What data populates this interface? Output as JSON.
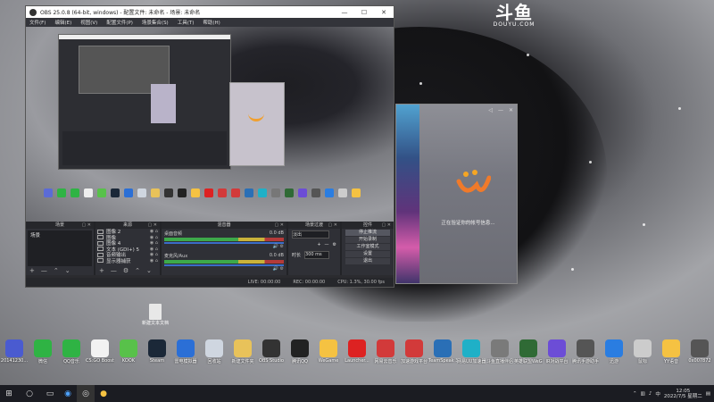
{
  "douyu": {
    "logo_glyph": "斗鱼",
    "url": "DOUYU.COM"
  },
  "obs": {
    "title": "OBS 25.0.8 (64-bit, windows) - 配置文件: 未命名 - 场景: 未命名",
    "menu": [
      "文件(F)",
      "编辑(E)",
      "视图(V)",
      "配置文件(P)",
      "场景集合(S)",
      "工具(T)",
      "帮助(H)"
    ],
    "docks": {
      "scenes": {
        "title": "场景",
        "items": [
          "场景"
        ]
      },
      "sources": {
        "title": "来源",
        "items": [
          {
            "name": "图像 2"
          },
          {
            "name": "图像"
          },
          {
            "name": "图像 4"
          },
          {
            "name": "文本 (GDI+) 5"
          },
          {
            "name": "音频输出"
          },
          {
            "name": "显示器捕获"
          }
        ]
      },
      "mixer": {
        "title": "混音器",
        "tracks": [
          {
            "name": "桌面音频",
            "db": "0.0 dB"
          },
          {
            "name": "麦克风/Aux",
            "db": "0.0 dB"
          }
        ]
      },
      "transitions": {
        "title": "场景过渡",
        "type": "淡出",
        "duration_label": "时长",
        "duration": "300 ms"
      },
      "controls": {
        "title": "控件",
        "buttons": [
          "停止推流",
          "开始录制",
          "工作室模式",
          "设置",
          "退出"
        ]
      }
    },
    "status": {
      "live": "LIVE: 00:00:00",
      "rec": "REC: 00:00:00",
      "cpu": "CPU: 1.3%, 30.00 fps"
    }
  },
  "douyu_panel": {
    "message": "正在验证你的帐号信息..."
  },
  "file_icon": {
    "label": "新建文本文档"
  },
  "desktop_icons": [
    {
      "label": "20141230...",
      "color": "#4a5bd0"
    },
    {
      "label": "微信",
      "color": "#2fb344"
    },
    {
      "label": "QQ音乐",
      "color": "#2fb344"
    },
    {
      "label": "CS:GO Booster",
      "color": "#f2f2f2"
    },
    {
      "label": "KOOK",
      "color": "#58c14a"
    },
    {
      "label": "Steam",
      "color": "#1b2838"
    },
    {
      "label": "雷电模拟器",
      "color": "#2b6fd6"
    },
    {
      "label": "回收站",
      "color": "#cfd6e0"
    },
    {
      "label": "新建文件夹",
      "color": "#e8c25a"
    },
    {
      "label": "OBS Studio",
      "color": "#333"
    },
    {
      "label": "腾讯QQ",
      "color": "#222"
    },
    {
      "label": "WeGame",
      "color": "#f5c242"
    },
    {
      "label": "Launcher...",
      "color": "#d22"
    },
    {
      "label": "网易云音乐",
      "color": "#d23a3a"
    },
    {
      "label": "加速游戏平台",
      "color": "#d23a3a"
    },
    {
      "label": "TeamSpeak 3",
      "color": "#2a6fb6"
    },
    {
      "label": "网易UU加速器",
      "color": "#1fb0c7"
    },
    {
      "label": "斗鱼直播伴侣",
      "color": "#7a7a7a"
    },
    {
      "label": "英雄联盟WeGame版",
      "color": "#2f6a35"
    },
    {
      "label": "IR对战平台",
      "color": "#6c4dd6"
    },
    {
      "label": "腾讯手游助手",
      "color": "#555"
    },
    {
      "label": "迅游",
      "color": "#2a7de1"
    },
    {
      "label": "鼠标",
      "color": "#ccc"
    },
    {
      "label": "YY语音",
      "color": "#f5c242"
    },
    {
      "label": "0x007872",
      "color": "#555"
    },
    {
      "label": "新建文本文档",
      "color": "#e8e8e8"
    }
  ],
  "taskbar": {
    "items": [
      "start-icon",
      "search-icon",
      "task-view-icon",
      "browser-icon",
      "obs-icon",
      "wegame-icon"
    ],
    "tray_text": "中",
    "time": "12:05",
    "date": "2022/7/5 星期二"
  }
}
